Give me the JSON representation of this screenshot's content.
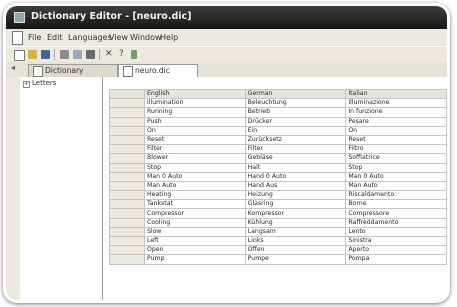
{
  "window": {
    "title": "Dictionary Editor - [neuro.dic]"
  },
  "menubar": {
    "items": [
      "File",
      "Edit",
      "Languages",
      "View",
      "Window",
      "Help"
    ]
  },
  "tabs": [
    {
      "label": "Dictionary"
    },
    {
      "label": "neuro.dic"
    }
  ],
  "tree": {
    "root_label": "Letters"
  },
  "table": {
    "columns": [
      "English",
      "German",
      "Italian"
    ],
    "rows": [
      [
        "Illumination",
        "Beleuchtung",
        "Illuminazione"
      ],
      [
        "Running",
        "Betrieb",
        "In funzione"
      ],
      [
        "Push",
        "Drücker",
        "Pesare"
      ],
      [
        "On",
        "Ein",
        "On"
      ],
      [
        "Reset",
        "Zurücksetz",
        "Reset"
      ],
      [
        "Filter",
        "Filter",
        "Filtro"
      ],
      [
        "Blower",
        "Gebläse",
        "Soffiatrice"
      ],
      [
        "Stop",
        "Halt",
        "Stop"
      ],
      [
        "Man 0 Auto",
        "Hand 0 Auto",
        "Man 0 Auto"
      ],
      [
        "Man Auto",
        "Hand Aus",
        "Man Auto"
      ],
      [
        "Heating",
        "Heizung",
        "Riscaldamento"
      ],
      [
        "Tankstat",
        "Glasring",
        "Borne"
      ],
      [
        "Compressor",
        "Kompressor",
        "Compressore"
      ],
      [
        "Cooling",
        "Kühlung",
        "Raffreddamento"
      ],
      [
        "Slow",
        "Langsam",
        "Lento"
      ],
      [
        "Left",
        "Links",
        "Sinistra"
      ],
      [
        "Open",
        "Offen",
        "Aperto"
      ],
      [
        "Pump",
        "Pumpe",
        "Pompa"
      ]
    ]
  },
  "colors": {
    "titlebar": "#1f1f1f",
    "chrome": "#ece9df",
    "grid_line": "#c5c5c5"
  }
}
